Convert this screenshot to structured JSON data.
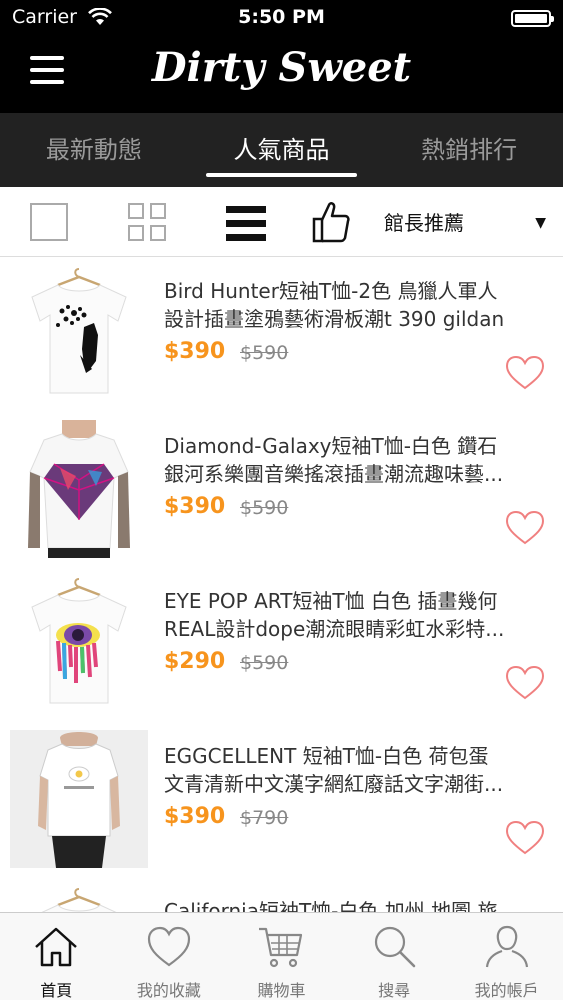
{
  "status": {
    "carrier": "Carrier",
    "time": "5:50 PM"
  },
  "header": {
    "logo": "Dirty Sweet",
    "menu_icon": "hamburger-menu-icon"
  },
  "tabs": [
    {
      "label": "最新動態",
      "active": false
    },
    {
      "label": "人氣商品",
      "active": true
    },
    {
      "label": "熱銷排行",
      "active": false
    }
  ],
  "toolbar": {
    "views": [
      "single-view-icon",
      "grid-view-icon",
      "list-view-icon",
      "thumbs-up-icon"
    ],
    "active_view": "list",
    "sort_value": "館長推薦",
    "caret": "▼"
  },
  "products": [
    {
      "name_line1": "Bird Hunter短袖T恤-2色 鳥獵人軍人",
      "name_line2": "設計插畫塗鴉藝術滑板潮t 390 gildan",
      "price": "$390",
      "original_price": "$590"
    },
    {
      "name_line1": "Diamond-Galaxy短袖T恤-白色 鑽石",
      "name_line2": "銀河系樂團音樂搖滾插畫潮流趣味藝...",
      "price": "$390",
      "original_price": "$590"
    },
    {
      "name_line1": "EYE POP ART短袖T恤 白色 插畫幾何",
      "name_line2": "REAL設計dope潮流眼睛彩虹水彩特...",
      "price": "$290",
      "original_price": "$590"
    },
    {
      "name_line1": "EGGCELLENT 短袖T恤-白色 荷包蛋",
      "name_line2": "文青清新中文漢字網紅廢話文字潮街...",
      "price": "$390",
      "original_price": "$790"
    },
    {
      "name_line1": "California短袖T恤-白色 加州 地圖 旅",
      "name_line2": "",
      "price": "",
      "original_price": ""
    }
  ],
  "tabbar": [
    {
      "label": "首頁",
      "icon": "home-icon",
      "active": true
    },
    {
      "label": "我的收藏",
      "icon": "heart-icon",
      "active": false
    },
    {
      "label": "購物車",
      "icon": "cart-icon",
      "active": false
    },
    {
      "label": "搜尋",
      "icon": "search-icon",
      "active": false
    },
    {
      "label": "我的帳戶",
      "icon": "user-icon",
      "active": false
    }
  ],
  "colors": {
    "price": "#f7941d",
    "heart": "#f08080",
    "header_bg": "#000000",
    "tabs_bg": "#222222"
  }
}
